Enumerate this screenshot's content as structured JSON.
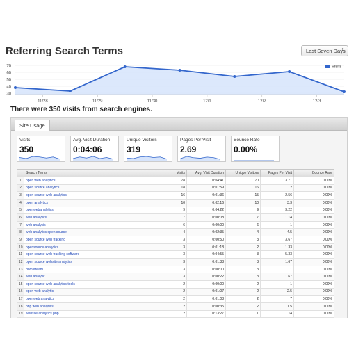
{
  "page": {
    "title": "Referring Search Terms",
    "range_select": "Last Seven Days",
    "summary": "There were 350 visits from search engines."
  },
  "chart_data": {
    "type": "area",
    "series": [
      {
        "name": "Visits",
        "values": [
          38,
          33,
          68,
          63,
          54,
          61,
          32
        ]
      }
    ],
    "y_ticks": [
      70,
      60,
      50,
      40,
      30
    ],
    "x_ticks": [
      "11/28",
      "11/29",
      "11/30",
      "12/1",
      "12/2",
      "12/3"
    ],
    "ylim": [
      28,
      72
    ],
    "legend_position": "top-right",
    "color": "#3366cc",
    "fill_color": "#d6e4fb"
  },
  "site_usage": {
    "tab_label": "Site Usage",
    "metrics": [
      {
        "label": "Visits",
        "value": "350",
        "spark": [
          6,
          4,
          8,
          7,
          5,
          7,
          3
        ]
      },
      {
        "label": "Avg. Visit Duration",
        "value": "0:04:06",
        "spark": [
          4,
          7,
          5,
          8,
          4,
          6,
          3
        ]
      },
      {
        "label": "Unique Visitors",
        "value": "319",
        "spark": [
          5,
          4,
          7,
          8,
          6,
          7,
          3
        ]
      },
      {
        "label": "Pages Per Visit",
        "value": "2.69",
        "spark": [
          3,
          7,
          5,
          4,
          6,
          5,
          2
        ]
      },
      {
        "label": "Bounce Rate",
        "value": "0.00%",
        "spark": [
          0,
          0,
          0,
          0,
          0,
          0,
          0
        ]
      }
    ]
  },
  "table": {
    "columns": [
      "Search Terms",
      "Visits",
      "Avg. Visit Duration",
      "Unique Visitors",
      "Pages Per Visit",
      "Bounce Rate"
    ],
    "rows": [
      [
        "1",
        "open web analytics",
        "78",
        "0:04:41",
        "70",
        "3.71",
        "0.00%"
      ],
      [
        "2",
        "open source analytics",
        "18",
        "0:01:59",
        "16",
        "2",
        "0.00%"
      ],
      [
        "3",
        "open source web analytics",
        "16",
        "0:01:36",
        "15",
        "2.56",
        "0.00%"
      ],
      [
        "4",
        "open analytics",
        "10",
        "0:02:16",
        "10",
        "3.3",
        "0.00%"
      ],
      [
        "5",
        "openwebanalytics",
        "9",
        "0:04:22",
        "9",
        "3.22",
        "0.00%"
      ],
      [
        "6",
        "web analytics",
        "7",
        "0:00:08",
        "7",
        "1.14",
        "0.00%"
      ],
      [
        "7",
        "web analysis",
        "6",
        "0:00:00",
        "6",
        "1",
        "0.00%"
      ],
      [
        "8",
        "web analytics open source",
        "4",
        "0:02:35",
        "4",
        "4.5",
        "0.00%"
      ],
      [
        "9",
        "open source web tracking",
        "3",
        "0:00:50",
        "3",
        "3.67",
        "0.00%"
      ],
      [
        "10",
        "opensource analytics",
        "3",
        "0:01:18",
        "2",
        "1.33",
        "0.00%"
      ],
      [
        "11",
        "open source web tracking software",
        "3",
        "0:04:55",
        "3",
        "5.33",
        "0.00%"
      ],
      [
        "12",
        "open source website analytics",
        "3",
        "0:01:38",
        "3",
        "1.67",
        "0.00%"
      ],
      [
        "13",
        "domstream",
        "3",
        "0:00:00",
        "3",
        "1",
        "0.00%"
      ],
      [
        "14",
        "web analytic",
        "3",
        "0:00:22",
        "3",
        "1.67",
        "0.00%"
      ],
      [
        "15",
        "open source web analytics tools",
        "2",
        "0:00:00",
        "2",
        "1",
        "0.00%"
      ],
      [
        "16",
        "open web analytic",
        "2",
        "0:01:07",
        "2",
        "2.5",
        "0.00%"
      ],
      [
        "17",
        "openweb analytics",
        "2",
        "0:01:08",
        "2",
        "7",
        "0.00%"
      ],
      [
        "18",
        "php web analytics",
        "2",
        "0:00:35",
        "2",
        "1.5",
        "0.00%"
      ],
      [
        "19",
        "website analytics php",
        "2",
        "0:13:27",
        "1",
        "14",
        "0.00%"
      ]
    ]
  }
}
